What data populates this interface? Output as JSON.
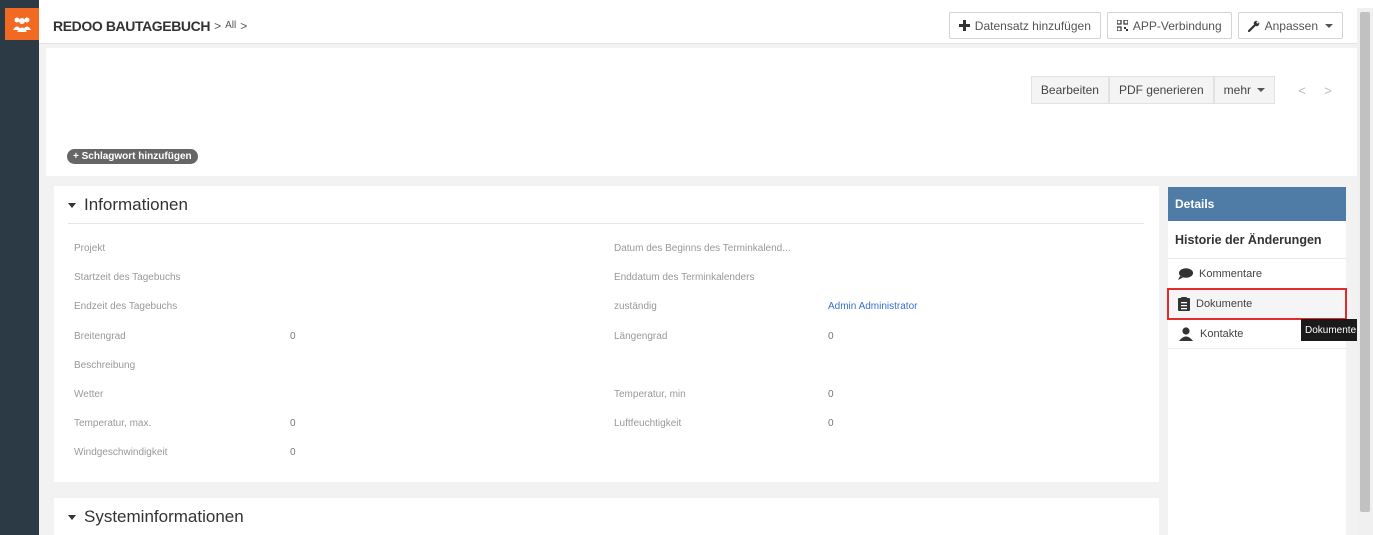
{
  "topbar": {
    "brand": "REDOO BAUTAGEBUCH",
    "breadcrumb_sep": ">",
    "breadcrumb_all": "All",
    "breadcrumb_sep2": ">",
    "add_record_label": "Datensatz hinzufügen",
    "app_connect_label": "APP-Verbindung",
    "customize_label": "Anpassen"
  },
  "record_actions": {
    "edit_label": "Bearbeiten",
    "pdf_label": "PDF generieren",
    "more_label": "mehr",
    "prev_label": "<",
    "next_label": ">"
  },
  "tag": {
    "add_tag_label": "+ Schlagwort hinzufügen"
  },
  "info_section": {
    "title": "Informationen",
    "left_fields": [
      {
        "label": "Projekt",
        "value": ""
      },
      {
        "label": "Startzeit des Tagebuchs",
        "value": ""
      },
      {
        "label": "Endzeit des Tagebuchs",
        "value": ""
      },
      {
        "label": "Breitengrad",
        "value": "0"
      },
      {
        "label": "Beschreibung",
        "value": ""
      },
      {
        "label": "Wetter",
        "value": ""
      },
      {
        "label": "Temperatur, max.",
        "value": "0"
      },
      {
        "label": "Windgeschwindigkeit",
        "value": "0"
      }
    ],
    "right_fields": [
      {
        "label": "Datum des Beginns des Terminkalend...",
        "value": ""
      },
      {
        "label": "Enddatum des Terminkalenders",
        "value": ""
      },
      {
        "label": "zuständig",
        "value": "Admin Administrator"
      },
      {
        "label": "Längengrad",
        "value": "0"
      },
      {
        "label": "Temperatur, min",
        "value": "0"
      },
      {
        "label": "Luftfeuchtigkeit",
        "value": "0"
      }
    ]
  },
  "system_section": {
    "title": "Systeminformationen"
  },
  "right_panel": {
    "details_label": "Details",
    "history_label": "Historie der Änderungen",
    "items": [
      {
        "label": "Kommentare",
        "icon": "comment-icon"
      },
      {
        "label": "Dokumente",
        "icon": "document-icon"
      },
      {
        "label": "Kontakte",
        "icon": "contact-icon"
      }
    ],
    "tooltip": "Dokumente"
  },
  "colors": {
    "accent_orange": "#f26a21",
    "panel_header_blue": "#4e7ca6",
    "link_blue": "#3b6fd1",
    "highlight_red": "#e32b2b"
  }
}
